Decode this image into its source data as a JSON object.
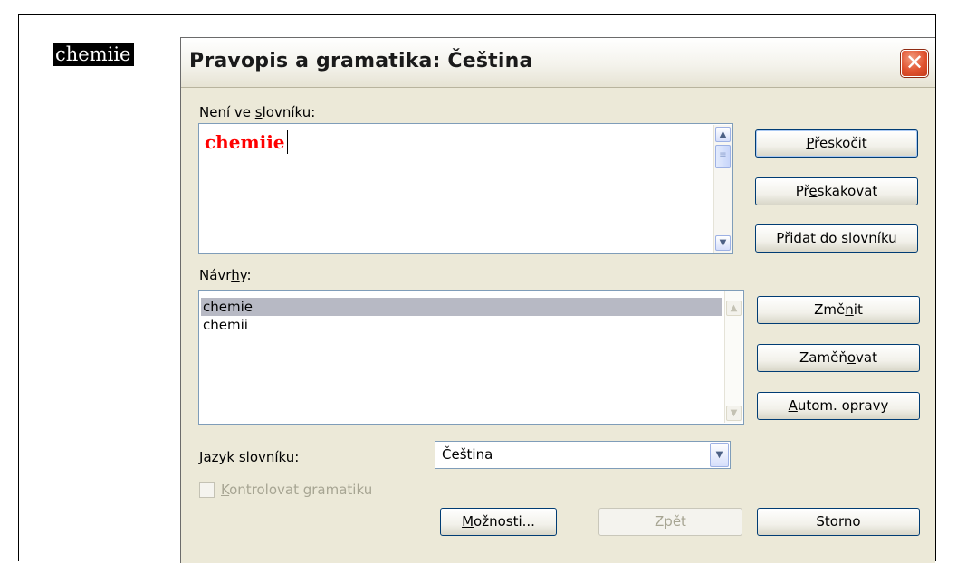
{
  "document": {
    "word": "chemiie"
  },
  "dialog": {
    "title": "Pravopis a gramatika: Čeština",
    "close_icon": "close-icon",
    "not_in_dictionary": {
      "label_pre": "Není ve ",
      "label_key": "s",
      "label_post": "lovníku:",
      "text": "chemiie"
    },
    "suggestions": {
      "label_pre": "Návr",
      "label_key": "h",
      "label_post": "y:",
      "items": [
        "chemie",
        "chemii"
      ],
      "selected_index": 0
    },
    "dictionary_language": {
      "label_key": "J",
      "label_post": "azyk slovníku:",
      "value": "Čeština"
    },
    "check_grammar": {
      "label_key": "K",
      "label_post": "ontrolovat gramatiku",
      "checked": false,
      "enabled": false
    },
    "buttons": {
      "ignore": {
        "pre": "",
        "key": "P",
        "post": "řeskočit"
      },
      "ignore_all": {
        "pre": "Př",
        "key": "e",
        "post": "skakovat"
      },
      "add": {
        "pre": "Při",
        "key": "d",
        "post": "at do slovníku"
      },
      "change": {
        "pre": "Změ",
        "key": "n",
        "post": "it"
      },
      "change_all": {
        "pre": "Zaměň",
        "key": "o",
        "post": "vat"
      },
      "autocorrect": {
        "pre": "",
        "key": "A",
        "post": "utom. opravy"
      },
      "options": {
        "pre": "",
        "key": "M",
        "post": "ožnosti..."
      },
      "undo": {
        "label": "Zpět",
        "enabled": false
      },
      "cancel": {
        "label": "Storno"
      }
    }
  }
}
